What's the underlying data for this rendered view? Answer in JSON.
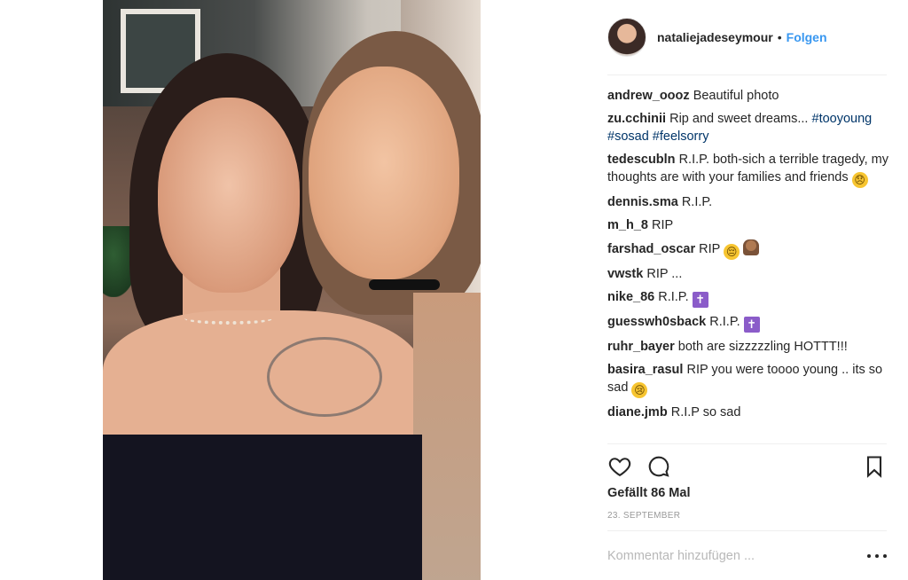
{
  "post": {
    "username": "nataliejadeseymour",
    "separator": "•",
    "follow_label": "Folgen"
  },
  "comments": [
    {
      "user": "andrew_oooz",
      "text": "Beautiful photo"
    },
    {
      "user": "zu.cchinii",
      "text": "Rip and sweet dreams...",
      "tags": [
        "#tooyoung",
        "#sosad",
        "#feelsorry"
      ]
    },
    {
      "user": "tedescubln",
      "text": "R.I.P. both-sich a terrible tragedy, my thoughts are with your families and friends",
      "emoji": "😞"
    },
    {
      "user": "dennis.sma",
      "text": "R.I.P."
    },
    {
      "user": "m_h_8",
      "text": "RIP"
    },
    {
      "user": "farshad_oscar",
      "text": "RIP",
      "emoji": "😔",
      "emoji2": "🙏"
    },
    {
      "user": "vwstk",
      "text": "RIP ..."
    },
    {
      "user": "nike_86",
      "text": "R.I.P.",
      "emoji": "✝"
    },
    {
      "user": "guesswh0sback",
      "text": "R.I.P.",
      "emoji": "✝"
    },
    {
      "user": "ruhr_bayer",
      "text": "both are sizzzzzling HOTTT!!!"
    },
    {
      "user": "basira_rasul",
      "text": "RIP you were toooo young .. its so sad",
      "emoji": "😢"
    },
    {
      "user": "diane.jmb",
      "text": "R.I.P so sad"
    }
  ],
  "actions": {
    "like_icon": "heart-icon",
    "comment_icon": "comment-bubble-icon",
    "save_icon": "bookmark-icon"
  },
  "likes_text": "Gefällt 86 Mal",
  "date_text": "23. SEPTEMBER",
  "comment_box": {
    "placeholder": "Kommentar hinzufügen ..."
  },
  "more_icon": "more-options-icon"
}
